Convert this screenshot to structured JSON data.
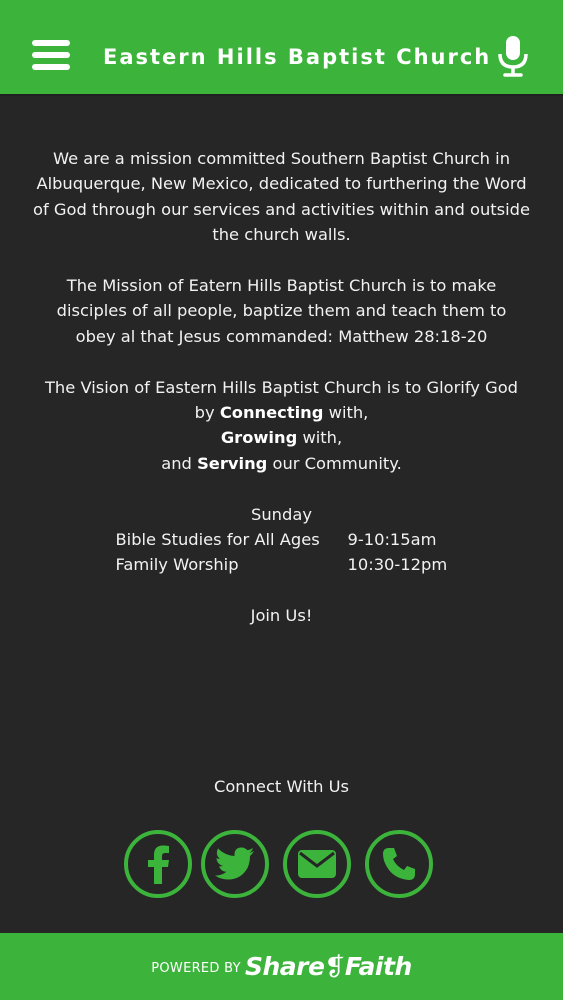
{
  "header": {
    "title": "Eastern Hills Baptist Church",
    "background_color": "#3cb43c",
    "menu_icon": "hamburger-menu-icon",
    "voice_icon": "microphone-icon"
  },
  "intro": {
    "paragraph": "We are a mission committed Southern Baptist Church in Albuquerque, New Mexico, dedicated to furthering the Word of God through our services and activities within and outside the church walls."
  },
  "mission": {
    "paragraph": "The Mission of Eatern Hills Baptist Church is to make disciples of all people, baptize them and teach them to obey al that Jesus commanded: Matthew 28:18-20"
  },
  "vision": {
    "lead": "The Vision of Eastern Hills Baptist Church is to Glorify God by",
    "connecting": "Connecting",
    "connecting_suffix": "with,",
    "growing": "Growing",
    "growing_suffix": "with,",
    "serving_prefix": "and",
    "serving": "Serving",
    "serving_suffix": "our Community."
  },
  "schedule": {
    "day": "Sunday",
    "items": [
      {
        "name": "Bible Studies for All Ages",
        "time": "9-10:15am"
      },
      {
        "name": "Family Worship",
        "time": "10:30-12pm"
      }
    ]
  },
  "join_text": "Join Us!",
  "connect": {
    "title": "Connect With Us",
    "accent_color": "#3cb43c",
    "buttons": [
      {
        "icon": "facebook-icon",
        "label": "Facebook"
      },
      {
        "icon": "twitter-icon",
        "label": "Twitter"
      },
      {
        "icon": "email-icon",
        "label": "Email"
      },
      {
        "icon": "phone-icon",
        "label": "Phone"
      }
    ]
  },
  "footer": {
    "powered_by": "POWERED BY",
    "brand": "SharefaithSharefaith",
    "brand_display": "Share❡Faith"
  }
}
